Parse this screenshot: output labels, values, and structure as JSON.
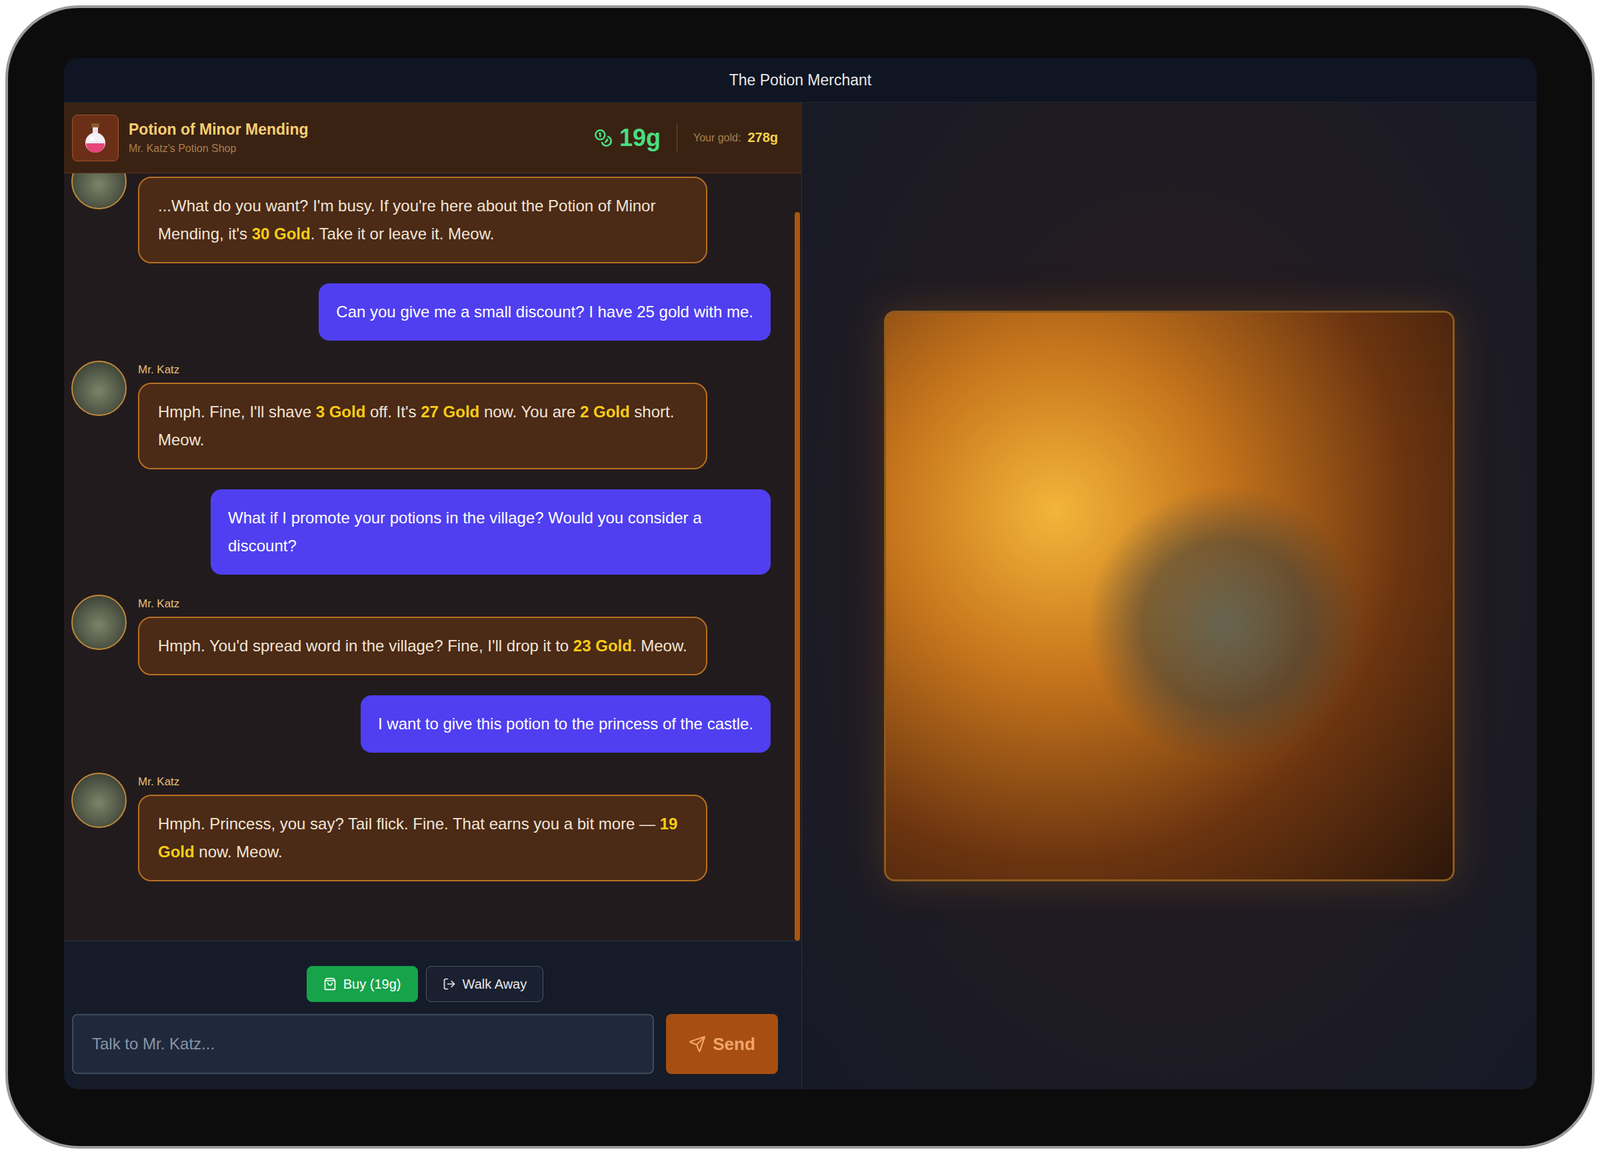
{
  "window": {
    "title": "The Potion Merchant"
  },
  "item": {
    "name": "Potion of Minor Mending",
    "shop": "Mr. Katz's Potion Shop",
    "price": "19g",
    "gold_label": "Your gold:",
    "gold": "278g"
  },
  "messages": [
    {
      "role": "merchant",
      "segments": [
        {
          "text": "...What do you want? I'm busy. If you're here about the Potion of Minor Mending, it's ",
          "highlight": false
        },
        {
          "text": "30 Gold",
          "highlight": true
        },
        {
          "text": ". Take it or leave it. Meow.",
          "highlight": false
        }
      ]
    },
    {
      "role": "user",
      "segments": [
        {
          "text": "Can you give me a small discount? I have 25 gold with me.",
          "highlight": false
        }
      ]
    },
    {
      "role": "merchant",
      "name": "Mr. Katz",
      "segments": [
        {
          "text": "Hmph. Fine, I'll shave ",
          "highlight": false
        },
        {
          "text": "3 Gold",
          "highlight": true
        },
        {
          "text": " off. It's ",
          "highlight": false
        },
        {
          "text": "27 Gold",
          "highlight": true
        },
        {
          "text": " now. You are ",
          "highlight": false
        },
        {
          "text": "2 Gold",
          "highlight": true
        },
        {
          "text": " short. Meow.",
          "highlight": false
        }
      ]
    },
    {
      "role": "user",
      "segments": [
        {
          "text": "What if I promote your potions in the village? Would you consider a discount?",
          "highlight": false
        }
      ]
    },
    {
      "role": "merchant",
      "name": "Mr. Katz",
      "segments": [
        {
          "text": "Hmph. You'd spread word in the village? Fine, I'll drop it to ",
          "highlight": false
        },
        {
          "text": "23 Gold",
          "highlight": true
        },
        {
          "text": ". Meow.",
          "highlight": false
        }
      ]
    },
    {
      "role": "user",
      "segments": [
        {
          "text": "I want to give this potion to the princess of the castle.",
          "highlight": false
        }
      ]
    },
    {
      "role": "merchant",
      "name": "Mr. Katz",
      "segments": [
        {
          "text": "Hmph. Princess, you say? Tail flick. Fine. That earns you a bit more — ",
          "highlight": false
        },
        {
          "text": "19 Gold",
          "highlight": true
        },
        {
          "text": " now. Meow.",
          "highlight": false
        }
      ]
    }
  ],
  "actions": [
    {
      "label": "Buy (19g)",
      "kind": "buy"
    },
    {
      "label": "Walk Away",
      "kind": "leave"
    }
  ],
  "input": {
    "placeholder": "Talk to Mr. Katz..."
  },
  "send": {
    "label": "Send",
    "disabled": true
  }
}
